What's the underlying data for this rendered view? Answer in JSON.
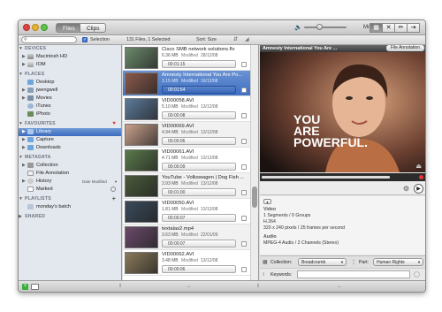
{
  "window": {
    "tabs": [
      {
        "label": "Files",
        "selected": true
      },
      {
        "label": "Clips",
        "selected": false
      }
    ],
    "mode_label": "Mode:",
    "mode_buttons": [
      {
        "icon": "list-view-icon",
        "selected": true
      },
      {
        "icon": "cut-icon",
        "selected": false
      },
      {
        "icon": "pencil-icon",
        "selected": false
      },
      {
        "icon": "export-icon",
        "selected": false
      }
    ],
    "volume_level": 0.35
  },
  "toolbar": {
    "search_placeholder": "",
    "selection_label": "Selection",
    "files_count": "131 Files, 1 Selected",
    "sort_label": "Sort: Size"
  },
  "sidebar": {
    "devices_header": "DEVICES",
    "devices": [
      {
        "label": "Macintosh HD",
        "icon": "hard-drive-icon"
      },
      {
        "label": "IOM",
        "icon": "drive-icon"
      }
    ],
    "places_header": "PLACES",
    "places": [
      {
        "label": "Desktop",
        "icon": "folder-icon"
      },
      {
        "label": "jwengwell",
        "icon": "home-icon"
      },
      {
        "label": "Movies",
        "icon": "movies-icon"
      },
      {
        "label": "iTunes",
        "icon": "itunes-icon"
      },
      {
        "label": "iPhoto",
        "icon": "iphoto-icon"
      }
    ],
    "favourites_header": "FAVOURITES",
    "favourites": [
      {
        "label": "Library",
        "selected": true
      },
      {
        "label": "Capture"
      },
      {
        "label": "Downloads"
      }
    ],
    "metadata_header": "METADATA",
    "metadata": [
      {
        "label": "Collection"
      },
      {
        "label": "File Annotation"
      },
      {
        "label": "History",
        "extra": "Date Modified"
      },
      {
        "label": "Marked"
      }
    ],
    "playlists_header": "PLAYLISTS",
    "playlists": [
      {
        "label": "monday's batch"
      }
    ],
    "shared_header": "SHARED"
  },
  "files": [
    {
      "title": "Cisco SMB network solutions.flv",
      "size": "6.36 MB",
      "modified_label": "Modified",
      "date": "28/12/08",
      "duration": "00:01:15",
      "selected": false,
      "thumb": "#6c8a6c"
    },
    {
      "title": "Amnesty International  You Are Po...",
      "size": "3.15 MB",
      "modified_label": "Modified",
      "date": "16/12/08",
      "duration": "00:01:54",
      "selected": true,
      "thumb": "#8a5a4a"
    },
    {
      "title": "VID00058.AVI",
      "size": "5.10 MB",
      "modified_label": "Modified",
      "date": "13/12/08",
      "duration": "00:00:08",
      "selected": false,
      "thumb": "#5c7a9a"
    },
    {
      "title": "VID00069.AVI",
      "size": "4.94 MB",
      "modified_label": "Modified",
      "date": "13/12/08",
      "duration": "00:00:06",
      "selected": false,
      "thumb": "#c9a08a"
    },
    {
      "title": "VID00061.AVI",
      "size": "4.71 MB",
      "modified_label": "Modified",
      "date": "13/12/08",
      "duration": "00:00:09",
      "selected": false,
      "thumb": "#5a7a4a"
    },
    {
      "title": "YouTube - Volkswagen | Dog Fish ...",
      "size": "3.93 MB",
      "modified_label": "Modified",
      "date": "13/12/08",
      "duration": "00:01:00",
      "selected": false,
      "thumb": "#4a5a3a"
    },
    {
      "title": "VID00050.AVI",
      "size": "1.81 MB",
      "modified_label": "Modified",
      "date": "13/12/08",
      "duration": "00:00:07",
      "selected": false,
      "thumb": "#3a4a5a"
    },
    {
      "title": "textalas2.mp4",
      "size": "3.63 MB",
      "modified_label": "Modified",
      "date": "22/01/09",
      "duration": "00:00:07",
      "selected": false,
      "thumb": "#6a4a6a"
    },
    {
      "title": "VID00062.AVI",
      "size": "3.48 MB",
      "modified_label": "Modified",
      "date": "13/12/08",
      "duration": "00:00:06",
      "selected": false,
      "thumb": "#8a7a5a"
    }
  ],
  "preview": {
    "title": "Amnesty International  You Are ...",
    "annotation_button": "File Annotation",
    "overlay_line1": "YOU",
    "overlay_line2": "ARE",
    "overlay_line3": "POWERFUL.",
    "progress": 0.85,
    "video_header": "Video",
    "video_segments": "1 Segments / 0 Groups",
    "codec": "H.264",
    "resolution": "320 x 240 pixels  /  25 frames per second",
    "audio_header": "Audio",
    "audio_codec": "MPEG-4 Audio / 2 Channels (Stereo)",
    "collection_label": "Collection:",
    "collection_value": "Breadcrumb",
    "part_label": "Part:",
    "part_value": "Human Rights",
    "keywords_label": "Keywords:",
    "keywords_value": ""
  }
}
